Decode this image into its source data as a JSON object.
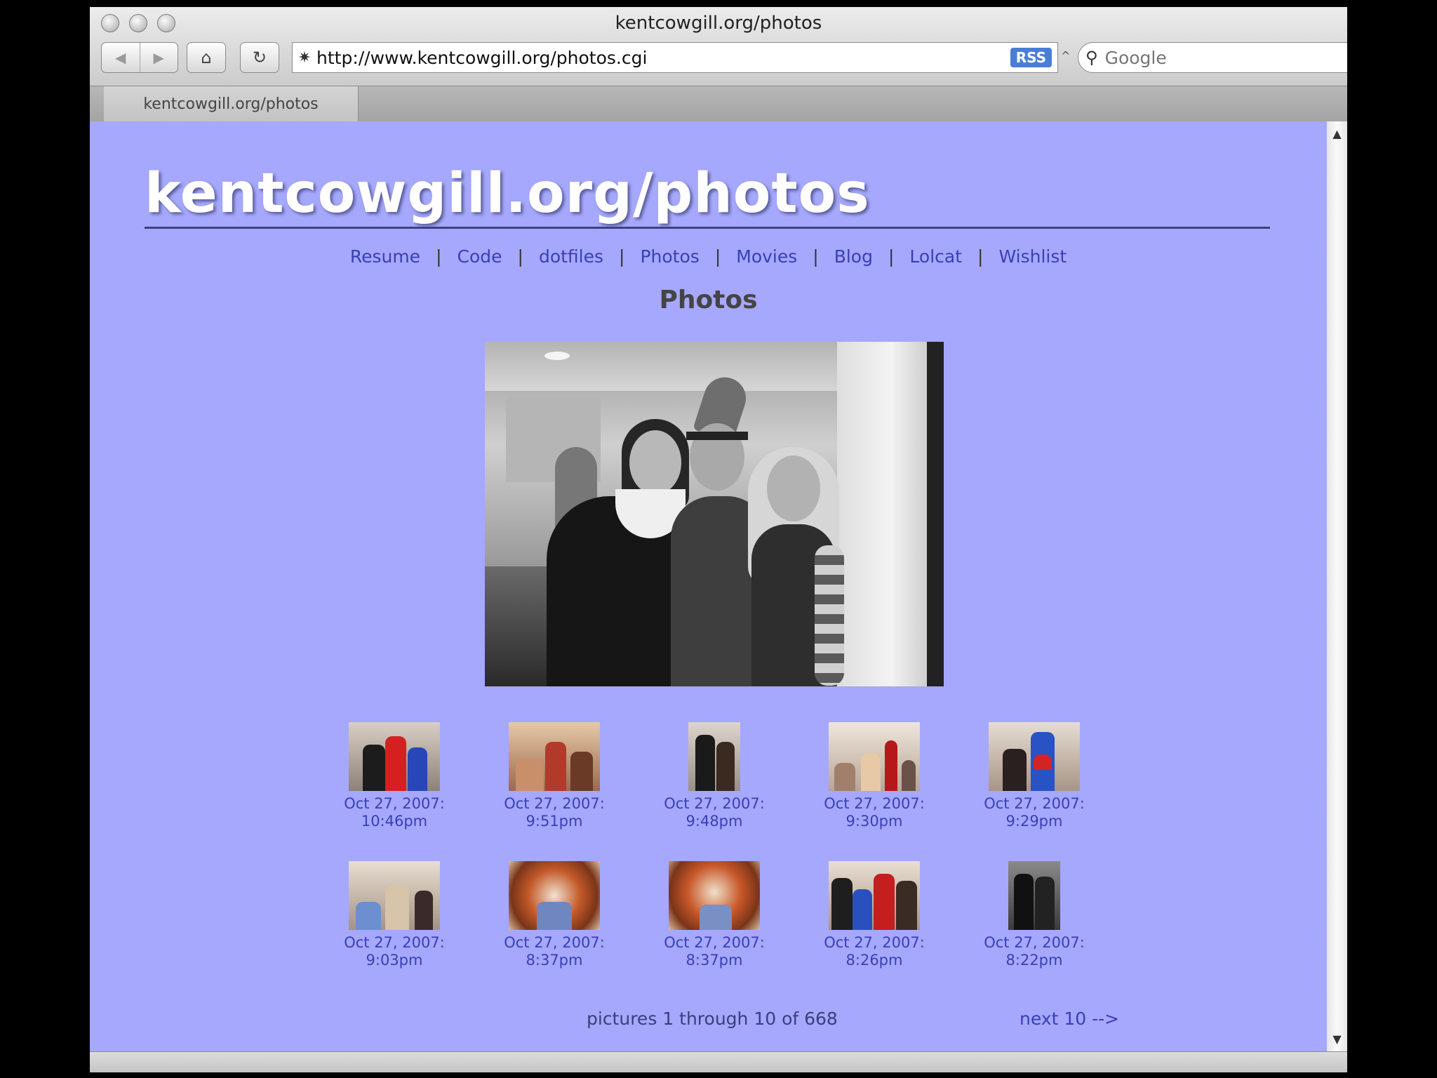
{
  "window": {
    "title": "kentcowgill.org/photos",
    "tab_label": "kentcowgill.org/photos"
  },
  "toolbar": {
    "back_icon": "back-arrow-icon",
    "forward_icon": "forward-arrow-icon",
    "home_icon": "home-icon",
    "reload_icon": "reload-icon",
    "url": "http://www.kentcowgill.org/photos.cgi",
    "rss_label": "RSS",
    "search_placeholder": "Google"
  },
  "page": {
    "site_title": "kentcowgill.org/photos",
    "nav": [
      "Resume",
      "Code",
      "dotfiles",
      "Photos",
      "Movies",
      "Blog",
      "Lolcat",
      "Wishlist"
    ],
    "nav_separator": "|",
    "heading": "Photos",
    "thumbnails": [
      {
        "date": "Oct 27, 2007:",
        "time": "10:46pm"
      },
      {
        "date": "Oct 27, 2007:",
        "time": "9:51pm"
      },
      {
        "date": "Oct 27, 2007:",
        "time": "9:48pm"
      },
      {
        "date": "Oct 27, 2007:",
        "time": "9:30pm"
      },
      {
        "date": "Oct 27, 2007:",
        "time": "9:29pm"
      },
      {
        "date": "Oct 27, 2007:",
        "time": "9:03pm"
      },
      {
        "date": "Oct 27, 2007:",
        "time": "8:37pm"
      },
      {
        "date": "Oct 27, 2007:",
        "time": "8:37pm"
      },
      {
        "date": "Oct 27, 2007:",
        "time": "8:26pm"
      },
      {
        "date": "Oct 27, 2007:",
        "time": "8:22pm"
      }
    ],
    "pager_text": "pictures 1 through 10 of 668",
    "next_link": "next 10 -->"
  },
  "colors": {
    "page_background": "#a5a8fc",
    "link": "#3a3fb4",
    "title_text": "#ffffff"
  }
}
